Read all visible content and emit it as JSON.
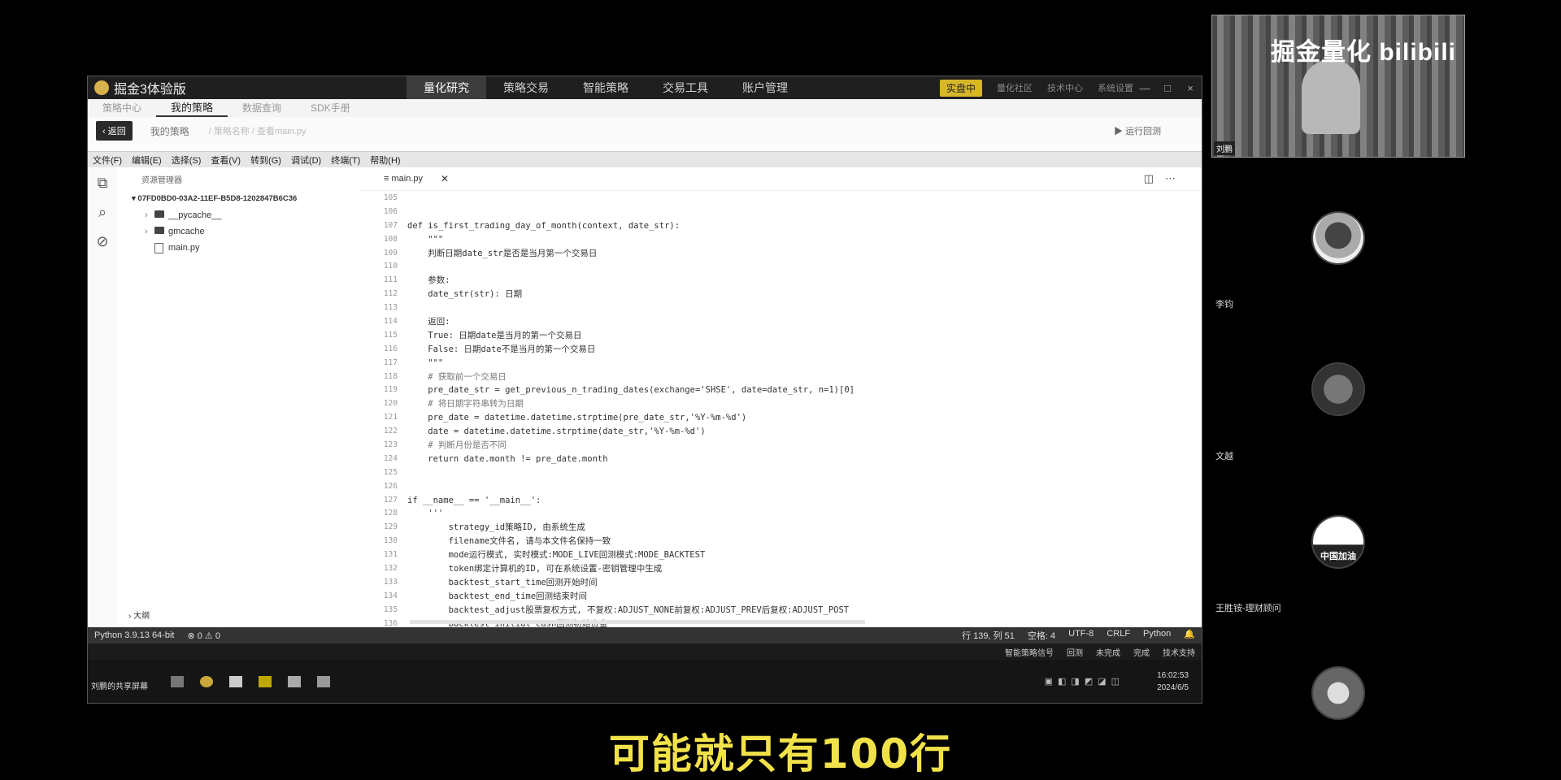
{
  "app": {
    "title": "掘金3体验版",
    "nav_tabs": [
      "量化研究",
      "策略交易",
      "智能策略",
      "交易工具",
      "账户管理"
    ],
    "live_badge": "实盘中",
    "top_links": [
      "量化社区",
      "技术中心",
      "系统设置"
    ],
    "window_buttons": [
      "—",
      "□",
      "×"
    ]
  },
  "subtabs": [
    "策略中心",
    "我的策略",
    "数据查询",
    "SDK手册"
  ],
  "toolrow": {
    "back": "返回",
    "crumb": "我的策略",
    "crumb2": "/ 策略名称 / 查看main.py",
    "run": "运行回测"
  },
  "menu": [
    "文件(F)",
    "编辑(E)",
    "选择(S)",
    "查看(V)",
    "转到(G)",
    "调试(D)",
    "终端(T)",
    "帮助(H)"
  ],
  "explorer": {
    "header": "资源管理器",
    "root": "07FD0BD0-03A2-11EF-B5D8-1202847B6C36",
    "items": [
      "__pycache__",
      "gmcache",
      "main.py"
    ],
    "outline": "大纲"
  },
  "editor": {
    "tab": "main.py",
    "lines": [
      {
        "n": "105",
        "t": ""
      },
      {
        "n": "106",
        "t": ""
      },
      {
        "n": "107",
        "t": "def is_first_trading_day_of_month(context, date_str):"
      },
      {
        "n": "108",
        "t": "    \"\"\""
      },
      {
        "n": "109",
        "t": "    判断日期date_str是否是当月第一个交易日"
      },
      {
        "n": "110",
        "t": ""
      },
      {
        "n": "111",
        "t": "    参数:"
      },
      {
        "n": "112",
        "t": "    date_str(str): 日期"
      },
      {
        "n": "113",
        "t": ""
      },
      {
        "n": "114",
        "t": "    返回:"
      },
      {
        "n": "115",
        "t": "    True: 日期date是当月的第一个交易日"
      },
      {
        "n": "116",
        "t": "    False: 日期date不是当月的第一个交易日"
      },
      {
        "n": "117",
        "t": "    \"\"\""
      },
      {
        "n": "118",
        "t": "    # 获取前一个交易日"
      },
      {
        "n": "119",
        "t": "    pre_date_str = get_previous_n_trading_dates(exchange='SHSE', date=date_str, n=1)[0]"
      },
      {
        "n": "120",
        "t": "    # 将日期字符串转为日期"
      },
      {
        "n": "121",
        "t": "    pre_date = datetime.datetime.strptime(pre_date_str,'%Y-%m-%d')"
      },
      {
        "n": "122",
        "t": "    date = datetime.datetime.strptime(date_str,'%Y-%m-%d')"
      },
      {
        "n": "123",
        "t": "    # 判断月份是否不同"
      },
      {
        "n": "124",
        "t": "    return date.month != pre_date.month"
      },
      {
        "n": "125",
        "t": ""
      },
      {
        "n": "126",
        "t": ""
      },
      {
        "n": "127",
        "t": "if __name__ == '__main__':"
      },
      {
        "n": "128",
        "t": "    '''"
      },
      {
        "n": "129",
        "t": "        strategy_id策略ID, 由系统生成"
      },
      {
        "n": "130",
        "t": "        filename文件名, 请与本文件名保持一致"
      },
      {
        "n": "131",
        "t": "        mode运行模式, 实时模式:MODE_LIVE回测模式:MODE_BACKTEST"
      },
      {
        "n": "132",
        "t": "        token绑定计算机的ID, 可在系统设置-密钥管理中生成"
      },
      {
        "n": "133",
        "t": "        backtest_start_time回测开始时间"
      },
      {
        "n": "134",
        "t": "        backtest_end_time回测结束时间"
      },
      {
        "n": "135",
        "t": "        backtest_adjust股票复权方式, 不复权:ADJUST_NONE前复权:ADJUST_PREV后复权:ADJUST_POST"
      },
      {
        "n": "136",
        "t": "        backtest_initial_cash回测初始资金"
      }
    ]
  },
  "statusbar": {
    "python": "Python 3.9.13 64-bit",
    "problems": "⊗ 0 ⚠ 0",
    "right": [
      "行 139, 列 51",
      "空格: 4",
      "UTF-8",
      "CRLF",
      "Python",
      "🔔"
    ]
  },
  "infobar": [
    "智能策略信号",
    "回测",
    "未完成",
    "完成",
    "技术支持"
  ],
  "taskbar": {
    "share": "刘鹏的共享屏幕",
    "time": "16:02:53",
    "date": "2024/6/5"
  },
  "camera": {
    "overlay": "掘金量化 bilibili",
    "name": "刘鹏"
  },
  "participants": [
    {
      "name": "李钧",
      "avatar_text": ""
    },
    {
      "name": "文越",
      "avatar_text": ""
    },
    {
      "name": "王胜铵-理财顾问",
      "avatar_text": "中国加油"
    },
    {
      "name": "",
      "avatar_text": ""
    }
  ],
  "subtitle": "可能就只有100行"
}
